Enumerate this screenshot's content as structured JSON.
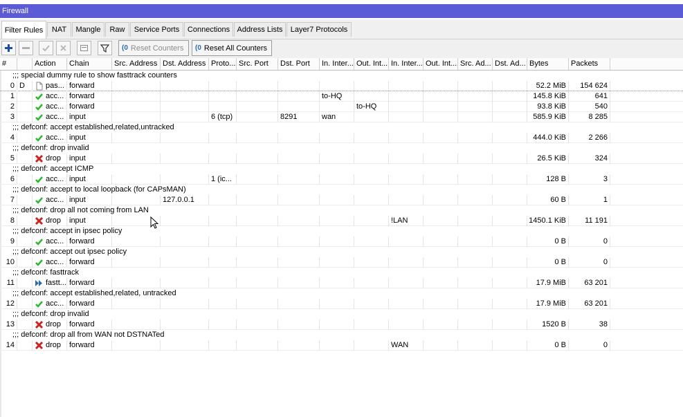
{
  "window": {
    "title": "Firewall",
    "title_bar_color": "#5b5bd6"
  },
  "tabs": [
    {
      "label": "Filter Rules",
      "active": true
    },
    {
      "label": "NAT",
      "active": false
    },
    {
      "label": "Mangle",
      "active": false
    },
    {
      "label": "Raw",
      "active": false
    },
    {
      "label": "Service Ports",
      "active": false
    },
    {
      "label": "Connections",
      "active": false
    },
    {
      "label": "Address Lists",
      "active": false
    },
    {
      "label": "Layer7 Protocols",
      "active": false
    }
  ],
  "toolbar": {
    "icons": [
      "add-icon",
      "remove-icon",
      "enable-icon",
      "disable-icon",
      "comment-icon",
      "filter-icon"
    ],
    "reset_counters": "Reset Counters",
    "reset_all_counters": "Reset All Counters"
  },
  "columns": [
    "#",
    "",
    "Action",
    "Chain",
    "Src. Address",
    "Dst. Address",
    "Proto...",
    "Src. Port",
    "Dst. Port",
    "In. Inter...",
    "Out. Int...",
    "In. Inter...",
    "Out. Int...",
    "Src. Ad...",
    "Dst. Ad...",
    "Bytes",
    "Packets"
  ],
  "rows": [
    {
      "type": "comment",
      "text": ";;; special dummy rule to show fasttrack counters"
    },
    {
      "type": "rule",
      "num": "0",
      "flag": "D",
      "action": "pas...",
      "action_icon": "passthrough",
      "chain": "forward",
      "src_addr": "",
      "dst_addr": "",
      "proto": "",
      "src_port": "",
      "dst_port": "",
      "in_if": "",
      "out_if": "",
      "in_if_list": "",
      "out_if_list": "",
      "bytes": "52.2 MiB",
      "packets": "154 624"
    },
    {
      "type": "rule",
      "num": "1",
      "flag": "",
      "action": "acc...",
      "action_icon": "accept",
      "chain": "forward",
      "src_addr": "",
      "dst_addr": "",
      "proto": "",
      "src_port": "",
      "dst_port": "",
      "in_if": "to-HQ",
      "out_if": "",
      "in_if_list": "",
      "out_if_list": "",
      "bytes": "145.8 KiB",
      "packets": "641"
    },
    {
      "type": "rule",
      "num": "2",
      "flag": "",
      "action": "acc...",
      "action_icon": "accept",
      "chain": "forward",
      "src_addr": "",
      "dst_addr": "",
      "proto": "",
      "src_port": "",
      "dst_port": "",
      "in_if": "",
      "out_if": "to-HQ",
      "in_if_list": "",
      "out_if_list": "",
      "bytes": "93.8 KiB",
      "packets": "540"
    },
    {
      "type": "rule",
      "num": "3",
      "flag": "",
      "action": "acc...",
      "action_icon": "accept",
      "chain": "input",
      "src_addr": "",
      "dst_addr": "",
      "proto": "6 (tcp)",
      "src_port": "",
      "dst_port": "8291",
      "in_if": "wan",
      "out_if": "",
      "in_if_list": "",
      "out_if_list": "",
      "bytes": "585.9 KiB",
      "packets": "8 285"
    },
    {
      "type": "comment",
      "text": ";;; defconf: accept established,related,untracked"
    },
    {
      "type": "rule",
      "num": "4",
      "flag": "",
      "action": "acc...",
      "action_icon": "accept",
      "chain": "input",
      "src_addr": "",
      "dst_addr": "",
      "proto": "",
      "src_port": "",
      "dst_port": "",
      "in_if": "",
      "out_if": "",
      "in_if_list": "",
      "out_if_list": "",
      "bytes": "444.0 KiB",
      "packets": "2 266"
    },
    {
      "type": "comment",
      "text": ";;; defconf: drop invalid"
    },
    {
      "type": "rule",
      "num": "5",
      "flag": "",
      "action": "drop",
      "action_icon": "drop",
      "chain": "input",
      "src_addr": "",
      "dst_addr": "",
      "proto": "",
      "src_port": "",
      "dst_port": "",
      "in_if": "",
      "out_if": "",
      "in_if_list": "",
      "out_if_list": "",
      "bytes": "26.5 KiB",
      "packets": "324"
    },
    {
      "type": "comment",
      "text": ";;; defconf: accept ICMP"
    },
    {
      "type": "rule",
      "num": "6",
      "flag": "",
      "action": "acc...",
      "action_icon": "accept",
      "chain": "input",
      "src_addr": "",
      "dst_addr": "",
      "proto": "1 (ic...",
      "src_port": "",
      "dst_port": "",
      "in_if": "",
      "out_if": "",
      "in_if_list": "",
      "out_if_list": "",
      "bytes": "128 B",
      "packets": "3"
    },
    {
      "type": "comment",
      "text": ";;; defconf: accept to local loopback (for CAPsMAN)"
    },
    {
      "type": "rule",
      "num": "7",
      "flag": "",
      "action": "acc...",
      "action_icon": "accept",
      "chain": "input",
      "src_addr": "",
      "dst_addr": "127.0.0.1",
      "proto": "",
      "src_port": "",
      "dst_port": "",
      "in_if": "",
      "out_if": "",
      "in_if_list": "",
      "out_if_list": "",
      "bytes": "60 B",
      "packets": "1"
    },
    {
      "type": "comment",
      "text": ";;; defconf: drop all not coming from LAN"
    },
    {
      "type": "rule",
      "num": "8",
      "flag": "",
      "action": "drop",
      "action_icon": "drop",
      "chain": "input",
      "src_addr": "",
      "dst_addr": "",
      "proto": "",
      "src_port": "",
      "dst_port": "",
      "in_if": "",
      "out_if": "",
      "in_if_list": "!LAN",
      "out_if_list": "",
      "bytes": "1450.1 KiB",
      "packets": "11 191"
    },
    {
      "type": "comment",
      "text": ";;; defconf: accept in ipsec policy"
    },
    {
      "type": "rule",
      "num": "9",
      "flag": "",
      "action": "acc...",
      "action_icon": "accept",
      "chain": "forward",
      "src_addr": "",
      "dst_addr": "",
      "proto": "",
      "src_port": "",
      "dst_port": "",
      "in_if": "",
      "out_if": "",
      "in_if_list": "",
      "out_if_list": "",
      "bytes": "0 B",
      "packets": "0"
    },
    {
      "type": "comment",
      "text": ";;; defconf: accept out ipsec policy"
    },
    {
      "type": "rule",
      "num": "10",
      "flag": "",
      "action": "acc...",
      "action_icon": "accept",
      "chain": "forward",
      "src_addr": "",
      "dst_addr": "",
      "proto": "",
      "src_port": "",
      "dst_port": "",
      "in_if": "",
      "out_if": "",
      "in_if_list": "",
      "out_if_list": "",
      "bytes": "0 B",
      "packets": "0"
    },
    {
      "type": "comment",
      "text": ";;; defconf: fasttrack"
    },
    {
      "type": "rule",
      "num": "11",
      "flag": "",
      "action": "fastt...",
      "action_icon": "fasttrack",
      "chain": "forward",
      "src_addr": "",
      "dst_addr": "",
      "proto": "",
      "src_port": "",
      "dst_port": "",
      "in_if": "",
      "out_if": "",
      "in_if_list": "",
      "out_if_list": "",
      "bytes": "17.9 MiB",
      "packets": "63 201"
    },
    {
      "type": "comment",
      "text": ";;; defconf: accept established,related, untracked"
    },
    {
      "type": "rule",
      "num": "12",
      "flag": "",
      "action": "acc...",
      "action_icon": "accept",
      "chain": "forward",
      "src_addr": "",
      "dst_addr": "",
      "proto": "",
      "src_port": "",
      "dst_port": "",
      "in_if": "",
      "out_if": "",
      "in_if_list": "",
      "out_if_list": "",
      "bytes": "17.9 MiB",
      "packets": "63 201"
    },
    {
      "type": "comment",
      "text": ";;; defconf: drop invalid"
    },
    {
      "type": "rule",
      "num": "13",
      "flag": "",
      "action": "drop",
      "action_icon": "drop",
      "chain": "forward",
      "src_addr": "",
      "dst_addr": "",
      "proto": "",
      "src_port": "",
      "dst_port": "",
      "in_if": "",
      "out_if": "",
      "in_if_list": "",
      "out_if_list": "",
      "bytes": "1520 B",
      "packets": "38"
    },
    {
      "type": "comment",
      "text": ";;; defconf: drop all from WAN not DSTNATed"
    },
    {
      "type": "rule",
      "num": "14",
      "flag": "",
      "action": "drop",
      "action_icon": "drop",
      "chain": "forward",
      "src_addr": "",
      "dst_addr": "",
      "proto": "",
      "src_port": "",
      "dst_port": "",
      "in_if": "",
      "out_if": "",
      "in_if_list": "WAN",
      "out_if_list": "",
      "bytes": "0 B",
      "packets": "0"
    }
  ],
  "colors": {
    "accept": "#2eb82e",
    "drop": "#cc2222",
    "fasttrack": "#2a6ab0",
    "add": "#1a4fa0"
  }
}
